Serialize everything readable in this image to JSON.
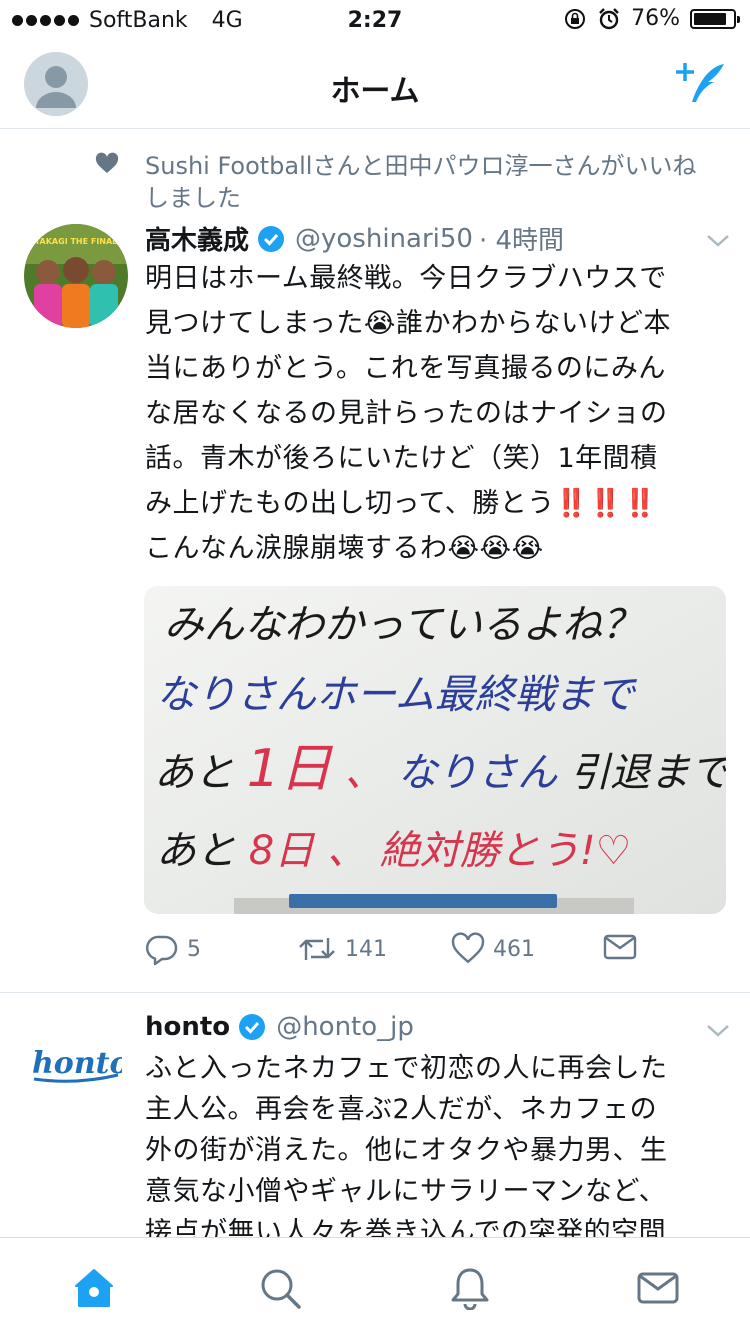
{
  "status": {
    "carrier": "SoftBank",
    "network": "4G",
    "time": "2:27",
    "battery": "76%"
  },
  "nav": {
    "title": "ホーム"
  },
  "tweet1": {
    "social_context": "Sushi Footballさんと田中パウロ淳一さんがいいねしました",
    "name": "高木義成",
    "handle": "@yoshinari50",
    "time": "· 4時間",
    "lines": [
      "明日はホーム最終戦。今日クラブハウスで",
      "見つけてしまった😭誰かわからないけど本",
      "当にありがとう。これを写真撮るのにみん",
      "な居なくなるの見計らったのはナイショの",
      "話。青木が後ろにいたけど（笑）1年間積",
      "み上げたもの出し切って、勝とう‼️‼️‼️",
      "こんなん涙腺崩壊するわ😭😭😭"
    ],
    "avatar_text": "TAKAGI THE FINAL",
    "image_text": {
      "line1": "みんなわかっているよね？",
      "line2": "なりさんホーム最終戦まで",
      "line3a": "あと",
      "line3b": "1日",
      "line3c": "、",
      "line3d": "なりさん",
      "line3e": "引退まで",
      "line4a": "あと",
      "line4b": "8日",
      "line4c": "、",
      "line4d": "絶対勝とう!♡"
    },
    "replies": "5",
    "retweets": "141",
    "likes": "461"
  },
  "tweet2": {
    "name": "honto",
    "handle": "@honto_jp",
    "logo_text": "honto",
    "lines": [
      "ふと入ったネカフェで初恋の人に再会した",
      "主人公。再会を喜ぶ2人だが、ネカフェの",
      "外の街が消えた。他にオタクや暴力男、生",
      "意気な小僧やギャルにサラリーマンなど、",
      "接点が無い人々を巻き込んでの突発的空間"
    ]
  },
  "colors": {
    "accent": "#1da1f2",
    "gray": "#657786",
    "like_red": "#e0245e"
  },
  "icons": [
    "signal-dots",
    "lock-rotation-icon",
    "alarm-icon",
    "battery-icon",
    "compose-icon",
    "heart-icon",
    "verified-icon",
    "chevron-down-icon",
    "reply-icon",
    "retweet-icon",
    "like-icon",
    "dm-icon",
    "home-icon",
    "search-icon",
    "notifications-icon",
    "messages-icon"
  ]
}
